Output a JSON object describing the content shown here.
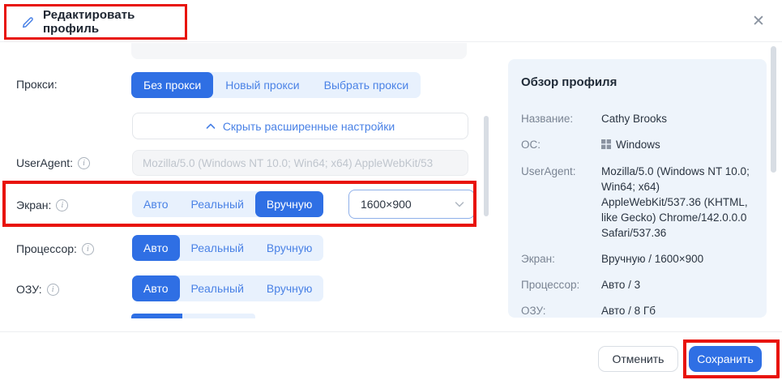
{
  "colors": {
    "accent_blue": "#2F6FE4",
    "segment_bg": "#E8F1FD",
    "segment_text": "#4A82E6",
    "annotation_red": "#E8130C",
    "panel_bg": "#EEF4FB"
  },
  "icons": {
    "info_glyph": "i",
    "close_glyph": "✕"
  },
  "header": {
    "title": "Редактировать профиль"
  },
  "form": {
    "proxy": {
      "label": "Прокси:",
      "options": [
        "Без прокси",
        "Новый прокси",
        "Выбрать прокси"
      ],
      "active": "Без прокси"
    },
    "advanced_toggle": {
      "label": "Скрыть расширенные настройки"
    },
    "useragent": {
      "label": "UserAgent:",
      "placeholder": "Mozilla/5.0 (Windows NT 10.0; Win64; x64) AppleWebKit/53"
    },
    "screen": {
      "label": "Экран:",
      "options": [
        "Авто",
        "Реальный",
        "Вручную"
      ],
      "active": "Вручную",
      "resolution_value": "1600×900"
    },
    "cpu": {
      "label": "Процессор:",
      "options": [
        "Авто",
        "Реальный",
        "Вручную"
      ],
      "active": "Авто"
    },
    "ram": {
      "label": "ОЗУ:",
      "options": [
        "Авто",
        "Реальный",
        "Вручную"
      ],
      "active": "Авто"
    }
  },
  "overview": {
    "title": "Обзор профиля",
    "rows": [
      {
        "label": "Название:",
        "value": "Cathy Brooks"
      },
      {
        "label": "ОС:",
        "value": "Windows"
      },
      {
        "label": "UserAgent:",
        "value": "Mozilla/5.0 (Windows NT 10.0; Win64; x64) AppleWebKit/537.36 (KHTML, like Gecko) Chrome/142.0.0.0 Safari/537.36"
      },
      {
        "label": "Экран:",
        "value": "Вручную / 1600×900"
      },
      {
        "label": "Процессор:",
        "value": "Авто / 3"
      },
      {
        "label": "ОЗУ:",
        "value": "Авто / 8 Гб"
      }
    ]
  },
  "footer": {
    "cancel_label": "Отменить",
    "save_label": "Сохранить"
  }
}
